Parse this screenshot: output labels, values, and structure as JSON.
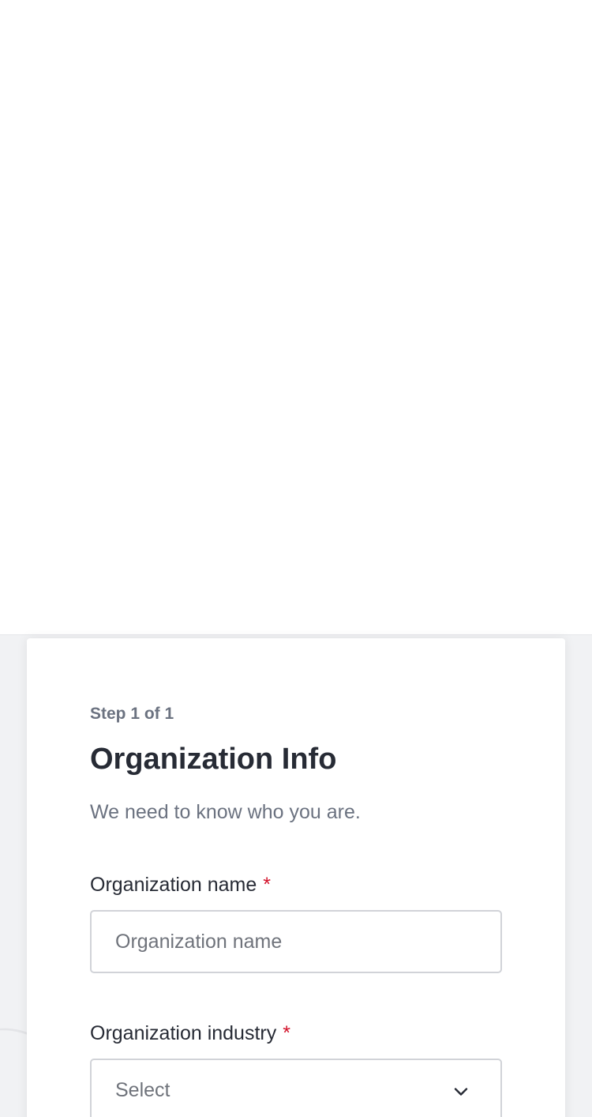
{
  "form": {
    "step_label": "Step 1 of 1",
    "title": "Organization Info",
    "subtitle": "We need to know who you are.",
    "required_marker": "*",
    "fields": {
      "name": {
        "label": "Organization name",
        "placeholder": "Organization name",
        "value": ""
      },
      "industry": {
        "label": "Organization industry",
        "selected": "Select",
        "icon": "chevron-down-icon"
      }
    }
  },
  "colors": {
    "text_primary": "#272b35",
    "text_secondary": "#6b7280",
    "required": "#d3122a",
    "border": "#d1d3d8",
    "background": "#f1f2f4"
  }
}
